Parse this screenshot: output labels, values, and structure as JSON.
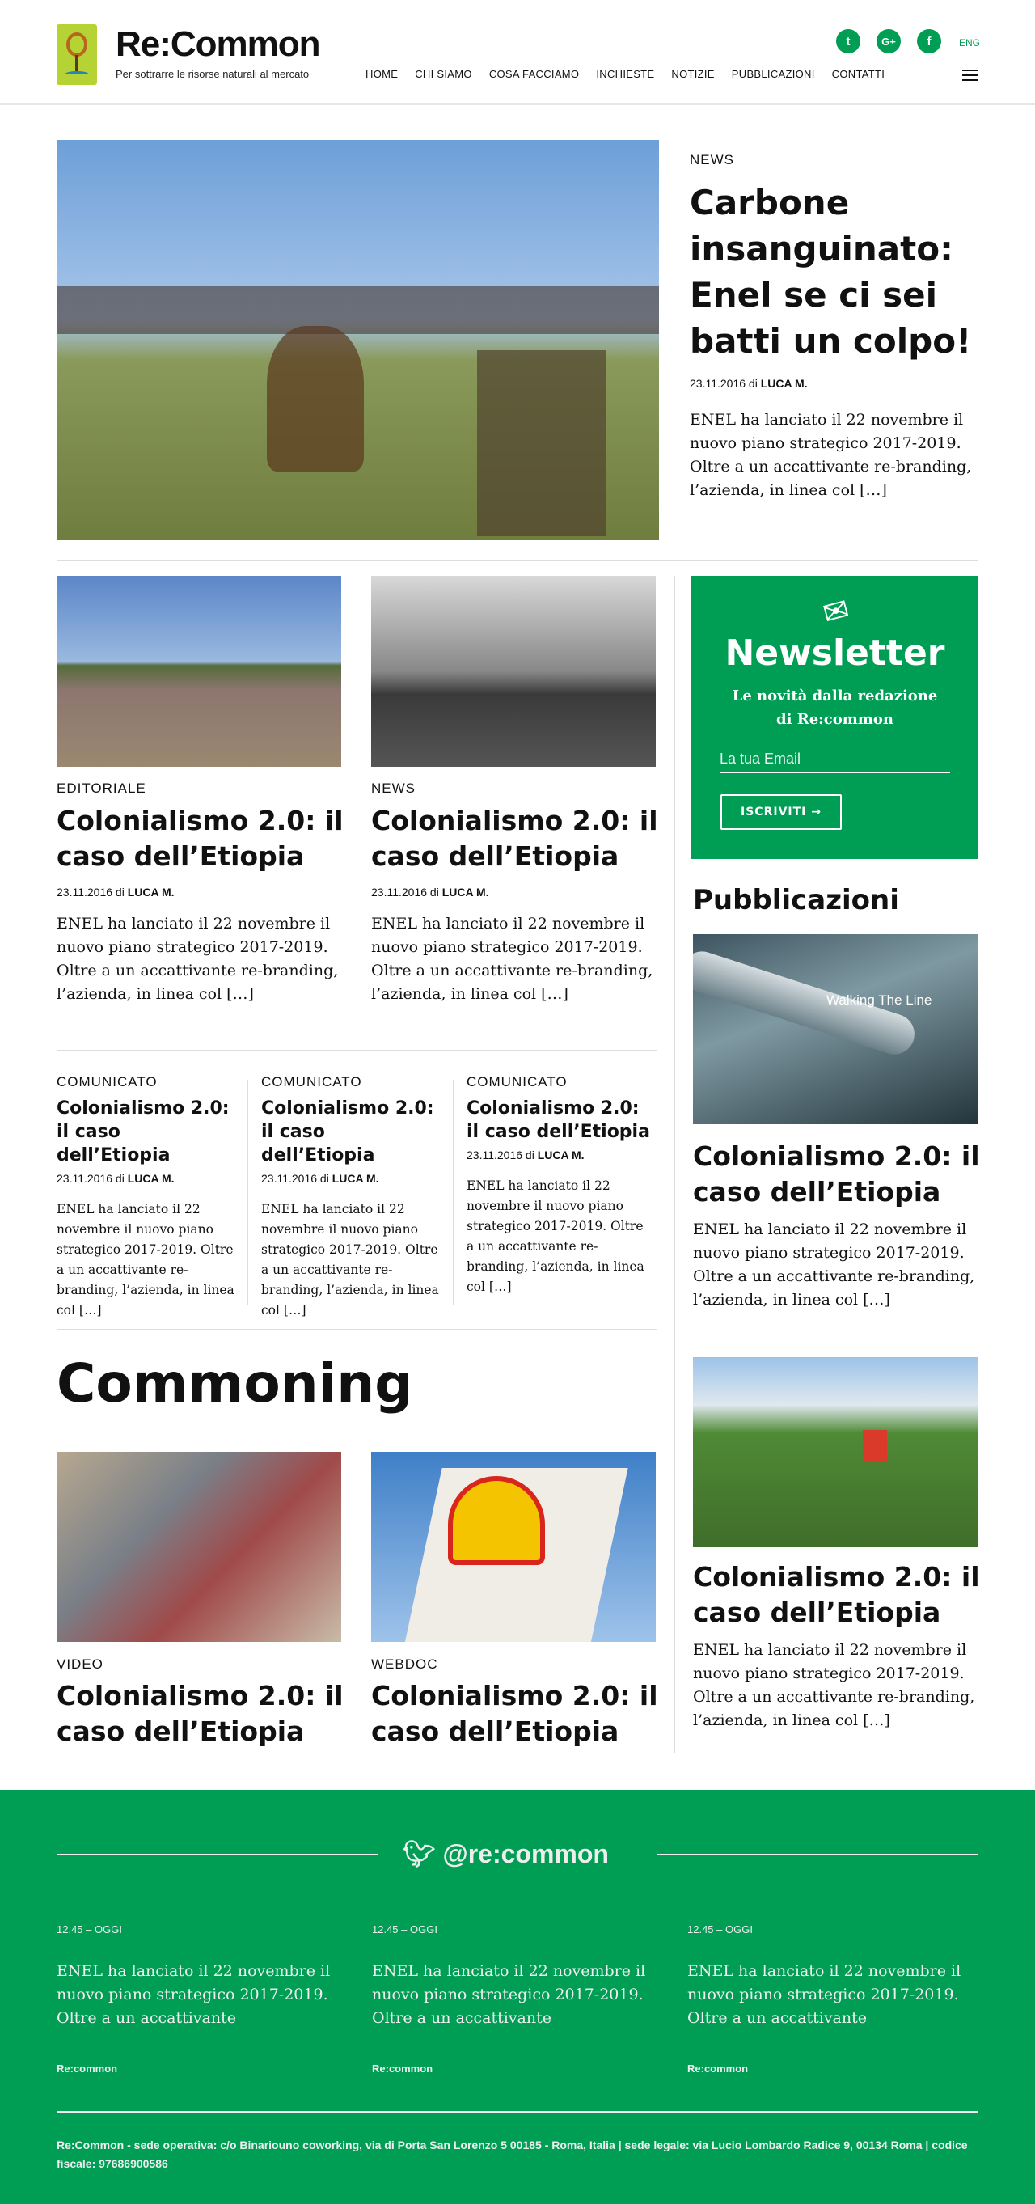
{
  "header": {
    "logo_title": "Re:Common",
    "logo_subtitle": "Per sottrarre le risorse naturali al mercato",
    "nav": [
      "HOME",
      "CHI SIAMO",
      "COSA FACCIAMO",
      "INCHIESTE",
      "NOTIZIE",
      "PUBBLICAZIONI",
      "CONTATTI"
    ],
    "social": [
      "t",
      "G+",
      "f"
    ],
    "lang": "ENG"
  },
  "colors": {
    "brand_green": "#009e55",
    "logo_green": "#b5d334"
  },
  "hero": {
    "label": "NEWS",
    "title": "Carbone insanguinato: Enel se ci sei batti un colpo!",
    "date": "23.11.2016 di",
    "author": "LUCA M.",
    "excerpt": "ENEL ha lanciato il 22 novembre il nuovo piano strategico 2017-2019. Oltre a un accattivante re-branding, l’azienda, in linea col […]"
  },
  "articles": [
    {
      "label": "EDITORIALE",
      "title": "Colonialismo 2.0: il caso dell’Etiopia",
      "date": "23.11.2016 di",
      "author": "LUCA M.",
      "excerpt": "ENEL ha lanciato il 22 novembre il nuovo piano strategico 2017-2019. Oltre a un accattivante re-branding, l’azienda, in linea col […]"
    },
    {
      "label": "NEWS",
      "title": "Colonialismo 2.0: il caso dell’Etiopia",
      "date": "23.11.2016 di",
      "author": "LUCA M.",
      "excerpt": "ENEL ha lanciato il 22 novembre il nuovo piano strategico 2017-2019. Oltre a un accattivante re-branding, l’azienda, in linea col […]"
    }
  ],
  "communicati": [
    {
      "label": "COMUNICATO",
      "title": "Colonialismo 2.0: il caso dell’Etiopia",
      "date": "23.11.2016 di",
      "author": "LUCA M.",
      "excerpt": "ENEL ha lanciato il 22 novembre il nuovo piano strategico 2017-2019. Oltre a un accattivante re-branding, l’azienda, in linea col  […]"
    },
    {
      "label": "COMUNICATO",
      "title": "Colonialismo 2.0: il caso dell’Etiopia",
      "date": "23.11.2016 di",
      "author": "LUCA M.",
      "excerpt": "ENEL ha lanciato il 22 novembre il nuovo piano strategico 2017-2019. Oltre a un accattivante re-branding, l’azienda, in linea col  […]"
    },
    {
      "label": "COMUNICATO",
      "title": "Colonialismo 2.0: il caso dell’Etiopia",
      "date": "23.11.2016 di",
      "author": "LUCA M.",
      "excerpt": "ENEL ha lanciato il 22 novembre il nuovo piano strategico 2017-2019. Oltre a un accattivante re-branding, l’azienda, in linea col  […]"
    }
  ],
  "commoning": {
    "heading": "Commoning",
    "items": [
      {
        "label": "VIDEO",
        "title": "Colonialismo 2.0: il caso dell’Etiopia"
      },
      {
        "label": "WEBDOC",
        "title": "Colonialismo 2.0: il caso dell’Etiopia"
      }
    ]
  },
  "newsletter": {
    "title": "Newsletter",
    "subtitle": "Le novità dalla redazione di Re:common",
    "email_placeholder": "La tua Email",
    "button": "ISCRIVITI →"
  },
  "publications": {
    "heading": "Pubblicazioni",
    "cover_title": "Walking The Line",
    "items": [
      {
        "title": "Colonialismo 2.0: il caso dell’Etiopia",
        "excerpt": "ENEL ha lanciato il 22 novembre il nuovo piano strategico 2017-2019. Oltre a un accattivante re-branding, l’azienda, in linea col […]"
      },
      {
        "title": "Colonialismo 2.0: il caso dell’Etiopia",
        "excerpt": "ENEL ha lanciato il 22 novembre il nuovo piano strategico 2017-2019. Oltre a un accattivante re-branding, l’azienda, in linea col […]"
      }
    ]
  },
  "twitter": {
    "handle": "@re:common",
    "tweets": [
      {
        "time": "12.45 – OGGI",
        "text": "ENEL ha lanciato il 22 novembre il nuovo piano strategico 2017-2019. Oltre a un accattivante",
        "author": "Re:common"
      },
      {
        "time": "12.45 – OGGI",
        "text": "ENEL ha lanciato il 22 novembre il nuovo piano strategico 2017-2019. Oltre a un accattivante",
        "author": "Re:common"
      },
      {
        "time": "12.45 – OGGI",
        "text": "ENEL ha lanciato il 22 novembre il nuovo piano strategico 2017-2019. Oltre a un accattivante",
        "author": "Re:common"
      }
    ]
  },
  "footer": {
    "address": "Re:Common - sede operativa: c/o Binariouno coworking, via di Porta San Lorenzo 5 00185 - Roma, Italia | sede legale: via Lucio Lombardo Radice 9, 00134 Roma | codice fiscale: 97686900586"
  }
}
